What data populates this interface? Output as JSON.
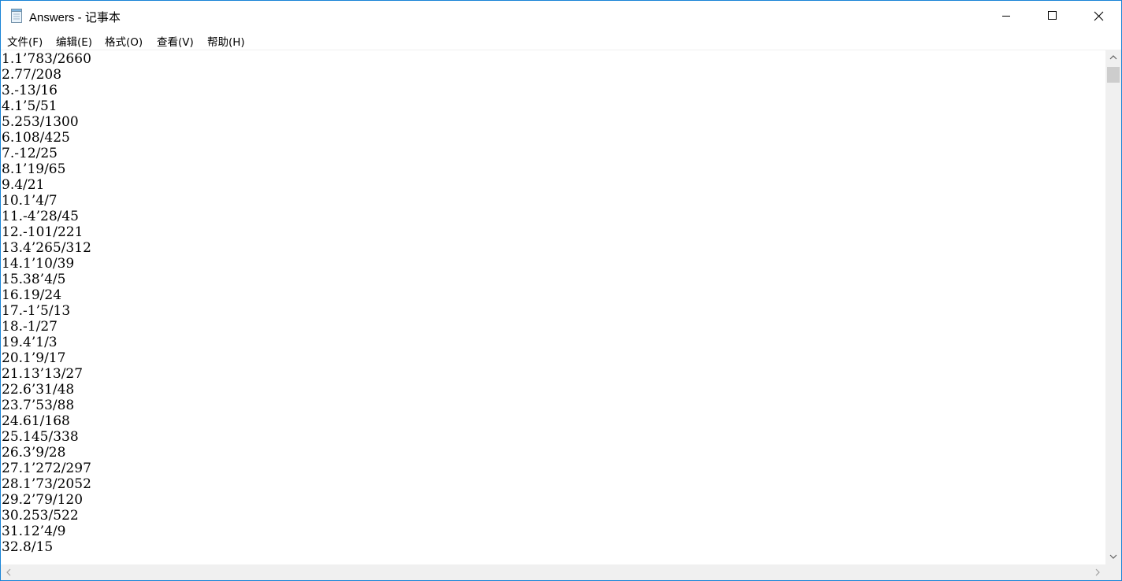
{
  "window": {
    "title": "Answers - 记事本",
    "border_color": "#1883d7"
  },
  "titlebar_buttons": {
    "minimize_icon": "minimize-icon",
    "maximize_icon": "maximize-icon",
    "close_icon": "close-icon"
  },
  "menu": {
    "items": [
      {
        "label": "文件(F)"
      },
      {
        "label": "编辑(E)"
      },
      {
        "label": "格式(O)"
      },
      {
        "label": "查看(V)"
      },
      {
        "label": "帮助(H)"
      }
    ]
  },
  "editor": {
    "lines": [
      "1.1’783/2660",
      "2.77/208",
      "3.-13/16",
      "4.1’5/51",
      "5.253/1300",
      "6.108/425",
      "7.-12/25",
      "8.1’19/65",
      "9.4/21",
      "10.1’4/7",
      "11.-4’28/45",
      "12.-101/221",
      "13.4’265/312",
      "14.1’10/39",
      "15.38’4/5",
      "16.19/24",
      "17.-1’5/13",
      "18.-1/27",
      "19.4’1/3",
      "20.1’9/17",
      "21.13’13/27",
      "22.6’31/48",
      "23.7’53/88",
      "24.61/168",
      "25.145/338",
      "26.3’9/28",
      "27.1’272/297",
      "28.1’73/2052",
      "29.2’79/120",
      "30.253/522",
      "31.12’4/9",
      "32.8/15"
    ]
  },
  "scrollbars": {
    "vertical": {
      "position": 0.0
    },
    "horizontal": {
      "position": 0.0
    }
  }
}
